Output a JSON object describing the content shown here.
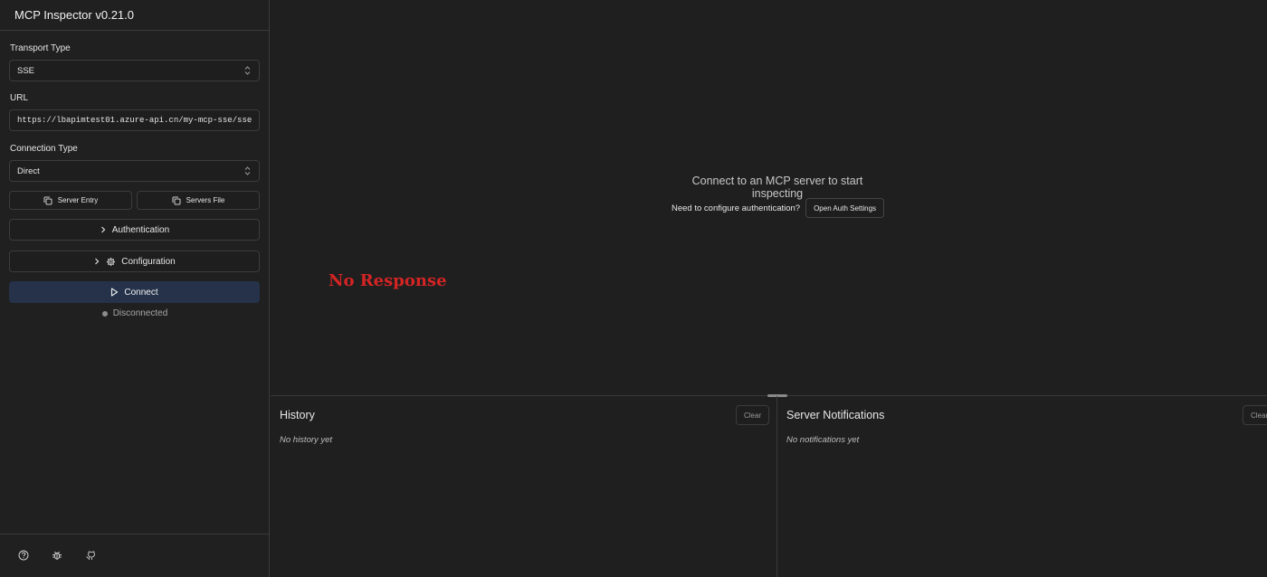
{
  "app": {
    "title": "MCP Inspector v0.21.0"
  },
  "sidebar": {
    "transport_label": "Transport Type",
    "transport_value": "SSE",
    "url_label": "URL",
    "url_value": "https://lbapimtest01.azure-api.cn/my-mcp-sse/sse",
    "connection_label": "Connection Type",
    "connection_value": "Direct",
    "server_entry_label": "Server Entry",
    "servers_file_label": "Servers File",
    "authentication_label": "Authentication",
    "configuration_label": "Configuration",
    "connect_label": "Connect",
    "status_text": "Disconnected"
  },
  "footer_icons": [
    "help-icon",
    "bug-icon",
    "github-icon"
  ],
  "main": {
    "placeholder": "Connect to an MCP server to start inspecting",
    "auth_question": "Need to configure authentication?",
    "auth_button": "Open Auth Settings",
    "overlay_text": "No Response"
  },
  "history": {
    "title": "History",
    "empty": "No history yet",
    "clear_label": "Clear"
  },
  "notifications": {
    "title": "Server Notifications",
    "empty": "No notifications yet",
    "clear_label": "Clear"
  },
  "colors": {
    "background": "#1f1f1f",
    "border": "#3a3a3a",
    "connect_bg": "#25324a",
    "overlay_red": "#d42424"
  }
}
